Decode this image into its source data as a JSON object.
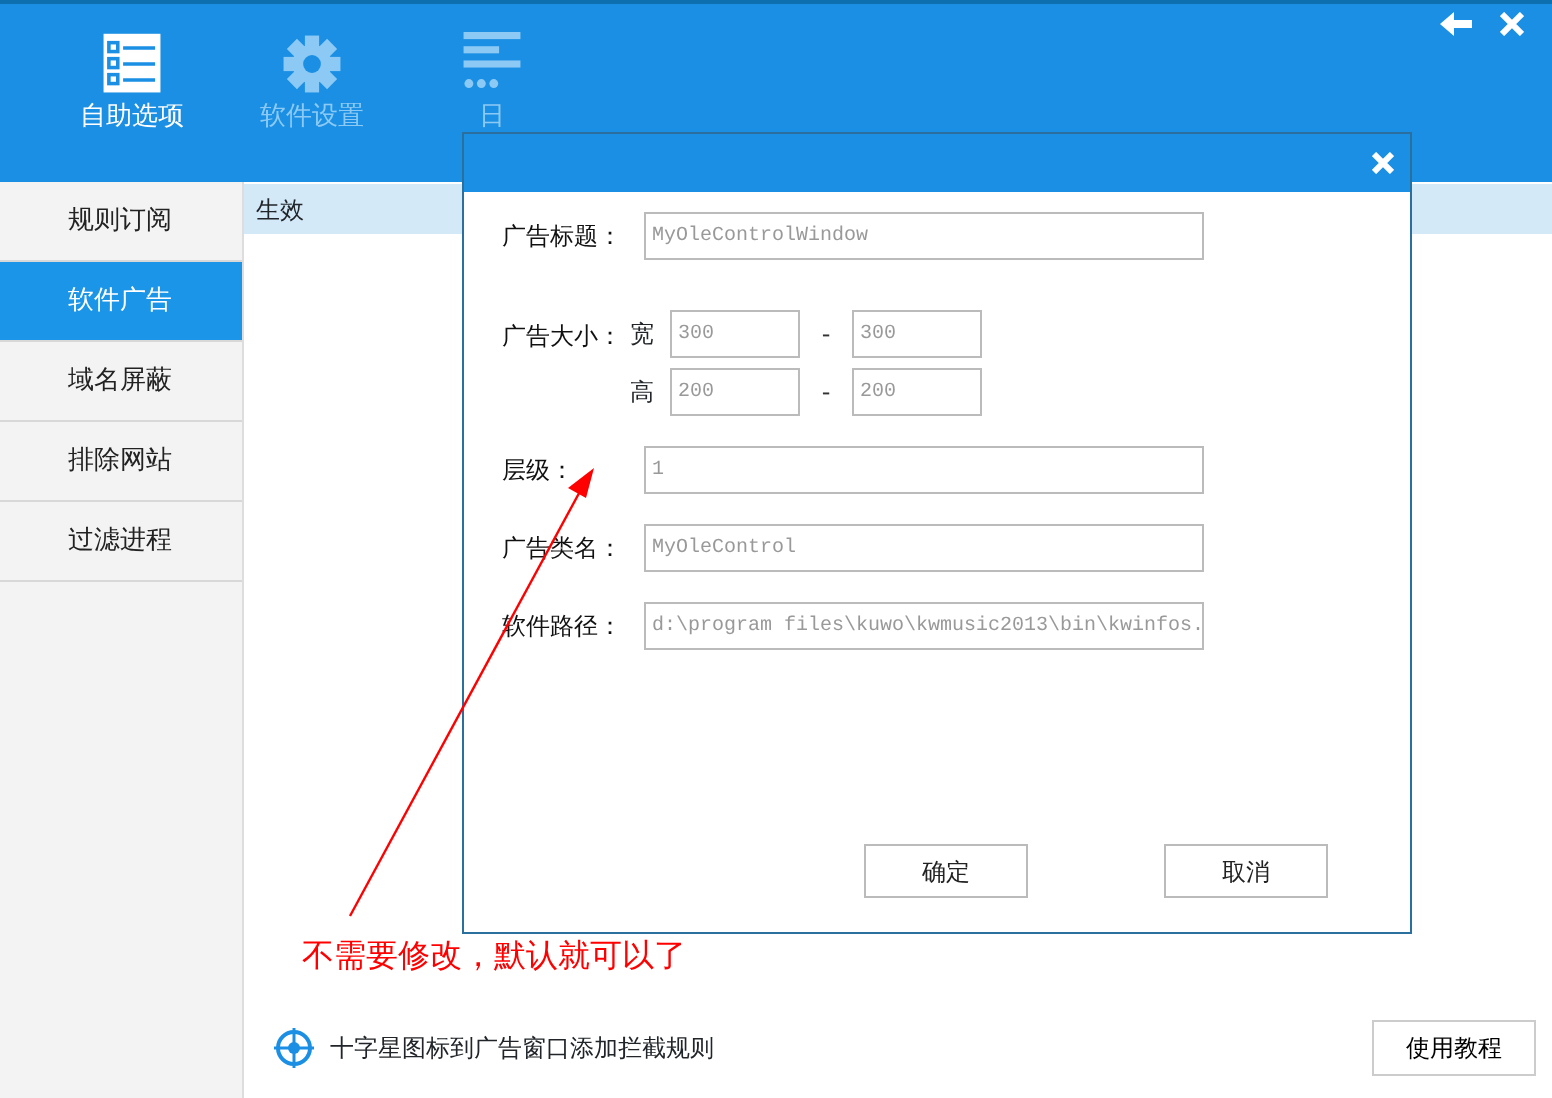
{
  "nav": [
    {
      "label": "自助选项",
      "selected": true
    },
    {
      "label": "软件设置",
      "selected": false
    },
    {
      "label": "日",
      "selected": false
    }
  ],
  "sidebar": {
    "items": [
      {
        "label": "规则订阅",
        "selected": false
      },
      {
        "label": "软件广告",
        "selected": true
      },
      {
        "label": "域名屏蔽",
        "selected": false
      },
      {
        "label": "排除网站",
        "selected": false
      },
      {
        "label": "过滤进程",
        "selected": false
      }
    ]
  },
  "table": {
    "columns": [
      "生效"
    ]
  },
  "dialog": {
    "fields": [
      {
        "kind": "text",
        "label": "广告标题：",
        "value": "MyOleControlWindow"
      },
      {
        "kind": "size",
        "label": "广告大小：",
        "rows": [
          {
            "label": "宽",
            "from": "300",
            "separator": "-",
            "to": "300"
          },
          {
            "label": "高",
            "from": "200",
            "separator": "-",
            "to": "200"
          }
        ]
      },
      {
        "kind": "text",
        "label": "层级：",
        "value": "1"
      },
      {
        "kind": "text",
        "label": "广告类名：",
        "value": "MyOleControl"
      },
      {
        "kind": "text",
        "label": "软件路径：",
        "value": "d:\\program files\\kuwo\\kwmusic2013\\bin\\kwinfos."
      }
    ],
    "buttons": [
      "确定",
      "取消"
    ]
  },
  "annotation": "不需要修改，默认就可以了",
  "footer": {
    "hint": "十字星图标到广告窗口添加拦截规则",
    "button": "使用教程"
  }
}
